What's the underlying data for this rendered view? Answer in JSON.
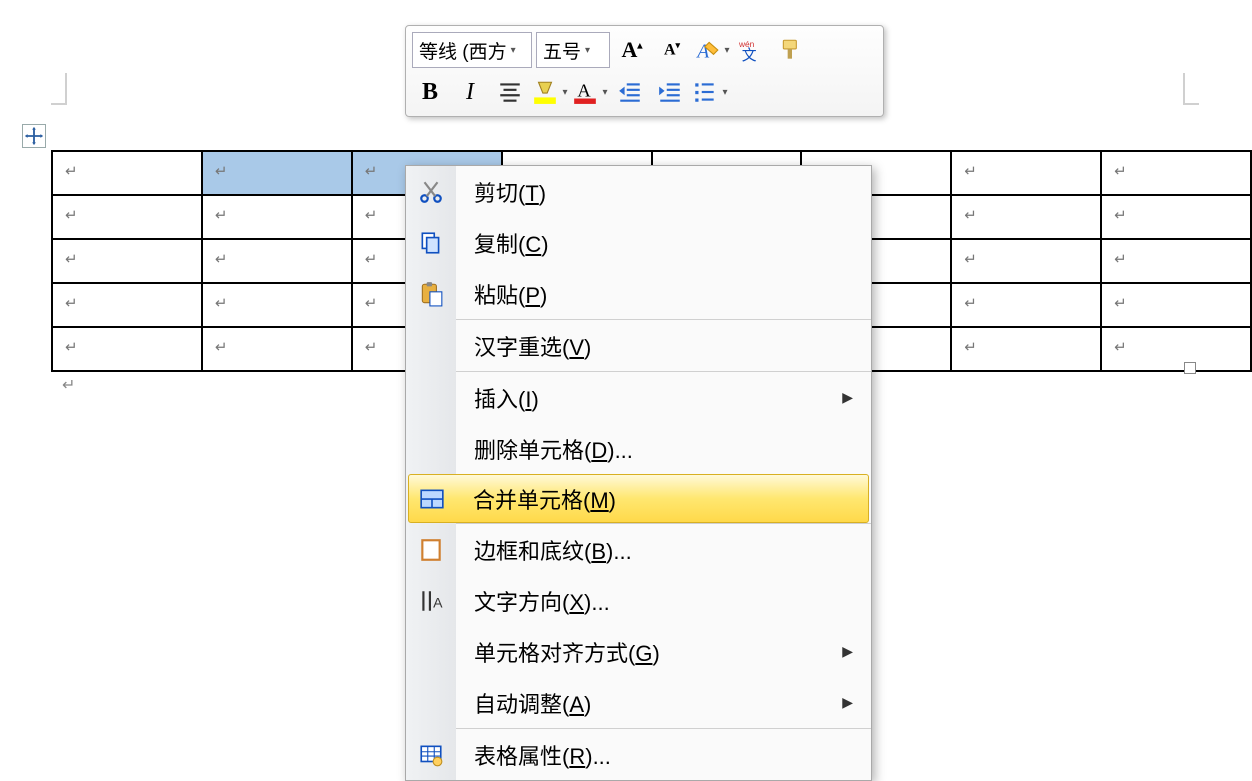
{
  "toolbar": {
    "font_name": "等线 (西方",
    "font_size": "五号"
  },
  "context_menu": {
    "cut": "剪切",
    "cut_key": "T",
    "copy": "复制",
    "copy_key": "C",
    "paste": "粘贴",
    "paste_key": "P",
    "reconvert": "汉字重选",
    "reconvert_key": "V",
    "insert": "插入",
    "insert_key": "I",
    "delete_cells": "删除单元格",
    "delete_cells_key": "D",
    "delete_cells_suffix": "...",
    "merge_cells": "合并单元格",
    "merge_cells_key": "M",
    "borders_shading": "边框和底纹",
    "borders_shading_key": "B",
    "borders_shading_suffix": "...",
    "text_direction": "文字方向",
    "text_direction_key": "X",
    "text_direction_suffix": "...",
    "cell_alignment": "单元格对齐方式",
    "cell_alignment_key": "G",
    "autofit": "自动调整",
    "autofit_key": "A",
    "table_props": "表格属性",
    "table_props_key": "R",
    "table_props_suffix": "..."
  },
  "table": {
    "rows": 5,
    "cols": 8,
    "selected_cells": [
      [
        0,
        1
      ],
      [
        0,
        2
      ]
    ]
  }
}
